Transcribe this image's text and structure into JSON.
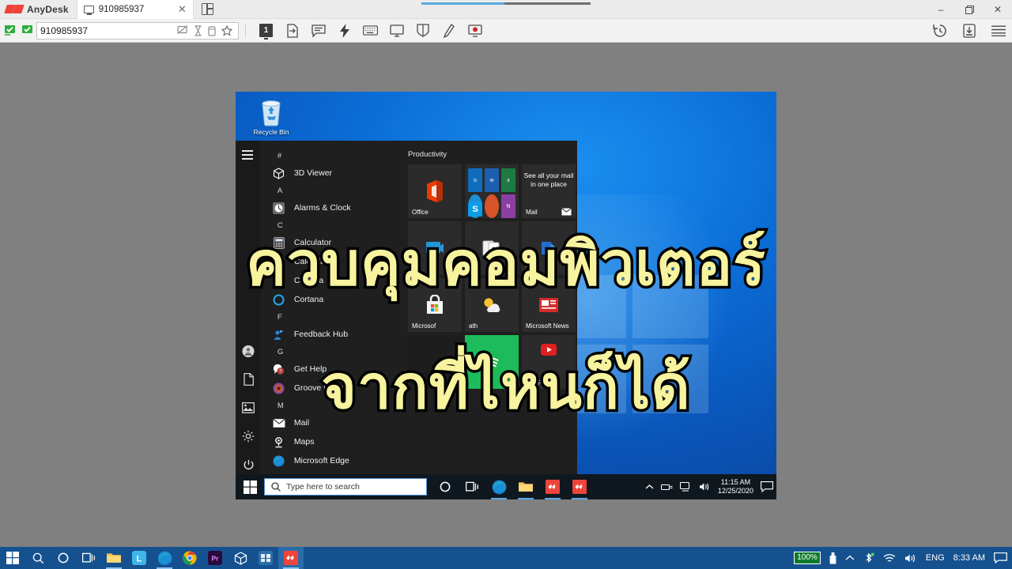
{
  "app": {
    "brand": "AnyDesk",
    "tab_label": "910985937",
    "tab_close": "✕",
    "new_tab_icon": "new-tab-icon",
    "window_controls": {
      "minimize": "–",
      "maximize": "❐",
      "close": "✕"
    }
  },
  "toolbar": {
    "address_value": "910985937",
    "address_icons": [
      "screen-block-icon",
      "hourglass-icon",
      "clipboard-icon",
      "star-icon"
    ],
    "monitor_number": "1",
    "buttons": [
      "monitor-select-button",
      "transfer-button",
      "chat-button",
      "action-button",
      "keyboard-button",
      "display-button",
      "permissions-button",
      "whiteboard-button",
      "record-button"
    ],
    "right_buttons": [
      "history-button",
      "download-button",
      "menu-button"
    ]
  },
  "remote": {
    "desktop": {
      "recycle_bin_label": "Recycle Bin"
    },
    "start_menu": {
      "rail_icons": [
        "hamburger-icon",
        "account-icon",
        "documents-icon",
        "pictures-icon",
        "settings-icon",
        "power-icon"
      ],
      "app_list": [
        {
          "type": "letter",
          "label": "#"
        },
        {
          "type": "app",
          "label": "3D Viewer",
          "icon": "3d-viewer-icon"
        },
        {
          "type": "letter",
          "label": "A"
        },
        {
          "type": "app",
          "label": "Alarms & Clock",
          "icon": "alarms-clock-icon"
        },
        {
          "type": "letter",
          "label": "C"
        },
        {
          "type": "app",
          "label": "Calculator",
          "icon": "calculator-icon"
        },
        {
          "type": "app",
          "label": "Calendar",
          "icon": "calendar-icon"
        },
        {
          "type": "app",
          "label": "Camera",
          "icon": "camera-icon"
        },
        {
          "type": "app",
          "label": "Cortana",
          "icon": "cortana-icon"
        },
        {
          "type": "letter",
          "label": "F"
        },
        {
          "type": "app",
          "label": "Feedback Hub",
          "icon": "feedback-hub-icon"
        },
        {
          "type": "letter",
          "label": "G"
        },
        {
          "type": "app",
          "label": "Get Help",
          "icon": "get-help-icon"
        },
        {
          "type": "app",
          "label": "Groove Music",
          "icon": "groove-music-icon"
        },
        {
          "type": "letter",
          "label": "M"
        },
        {
          "type": "app",
          "label": "Mail",
          "icon": "mail-icon"
        },
        {
          "type": "app",
          "label": "Maps",
          "icon": "maps-icon"
        },
        {
          "type": "app",
          "label": "Microsoft Edge",
          "icon": "edge-icon"
        }
      ],
      "tiles_group_title": "Productivity",
      "tiles": [
        {
          "label": "Office",
          "icon": "office-icon"
        },
        {
          "label": "",
          "icon": "office-apps-cluster-icon"
        },
        {
          "label": "Mail",
          "icon": "mail-tile-icon",
          "text": "See all your mail in one place"
        },
        {
          "label": "M",
          "icon": "movies-tv-icon"
        },
        {
          "label": "",
          "icon": "solitaire-icon"
        },
        {
          "label": "To...",
          "icon": "todo-icon"
        },
        {
          "label": "Microsof",
          "icon": "microsoft-store-icon"
        },
        {
          "label": "ath",
          "icon": "weather-icon"
        },
        {
          "label": "Microsoft News",
          "icon": "microsoft-news-icon"
        },
        {
          "label": "",
          "icon": "spotify-icon"
        },
        {
          "label": "Play",
          "icon": "play-icon"
        },
        {
          "label": "",
          "icon": "misc-tile-icon"
        }
      ]
    },
    "taskbar": {
      "start_icon": "windows-start-icon",
      "search_placeholder": "Type here to search",
      "items": [
        "cortana-circle-icon",
        "task-view-icon",
        "edge-icon",
        "file-explorer-icon",
        "anydesk-icon",
        "anydesk-icon-2"
      ],
      "tray": [
        "chevron-up-icon",
        "network-icon",
        "display-icon",
        "volume-icon"
      ],
      "clock_time": "11:15 AM",
      "clock_date": "12/25/2020",
      "action_center_icon": "action-center-icon"
    }
  },
  "overlay": {
    "line1": "ควบคุมคอมพิวเตอร์",
    "line2": "จากที่ไหนก็ได้",
    "fill_color": "#f7f39e",
    "stroke_color": "#000000"
  },
  "host_taskbar": {
    "items": [
      "windows-start-icon",
      "search-icon",
      "cortana-circle-icon",
      "task-view-icon",
      "file-explorer-icon",
      "line-icon",
      "edge-icon",
      "chrome-icon",
      "premiere-icon",
      "3d-viewer-icon",
      "app-icon",
      "anydesk-icon"
    ],
    "tray": {
      "battery_percent": "100%",
      "battery_icon": "battery-plug-icon",
      "chevron": "chevron-up-icon",
      "bluetooth_icon": "bluetooth-icon",
      "wifi_icon": "wifi-icon",
      "volume_icon": "volume-icon",
      "language": "ENG",
      "clock": "8:33 AM",
      "action_center_icon": "action-center-icon"
    }
  },
  "colors": {
    "anydesk_red": "#ef443b",
    "desktop_bg": "#808080",
    "start_menu_bg": "#1f1f1f",
    "taskbar_blue": "#15518f"
  }
}
